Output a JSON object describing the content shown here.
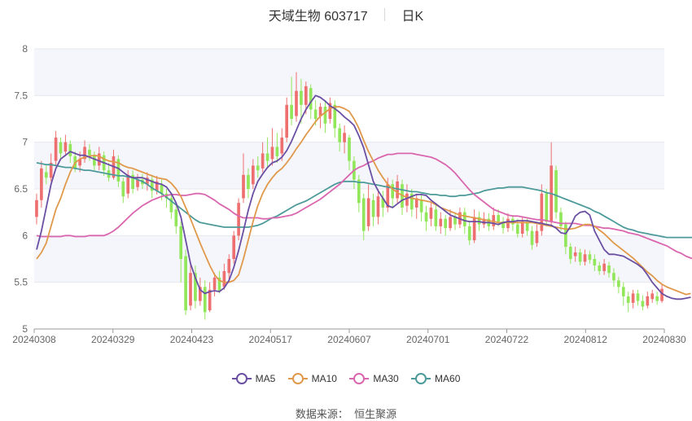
{
  "header": {
    "title": "天域生物 603717",
    "period": "日K"
  },
  "footer": {
    "source_label": "数据来源：",
    "source_name": "恒生聚源"
  },
  "colors": {
    "up": "#ee6f6f",
    "down": "#91e65a",
    "ma5": "#6a4fa3",
    "ma10": "#e0994b",
    "ma30": "#d966ae",
    "ma60": "#4d9a9a"
  },
  "chart_data": {
    "type": "candlestick",
    "x_tick_labels": [
      "20240308",
      "20240329",
      "20240423",
      "20240517",
      "20240607",
      "20240701",
      "20240722",
      "20240812",
      "20240830"
    ],
    "y_ticks": [
      "5",
      "5.5",
      "6",
      "6.5",
      "7",
      "7.5",
      "8"
    ],
    "ylim": [
      5,
      8
    ],
    "legend": [
      "MA5",
      "MA10",
      "MA30",
      "MA60"
    ],
    "candles": [
      {
        "o": 6.2,
        "c": 6.38,
        "h": 6.45,
        "l": 6.12
      },
      {
        "o": 6.38,
        "c": 6.72,
        "h": 6.8,
        "l": 6.3
      },
      {
        "o": 6.68,
        "c": 6.62,
        "h": 6.75,
        "l": 6.55
      },
      {
        "o": 6.62,
        "c": 6.78,
        "h": 6.88,
        "l": 6.58
      },
      {
        "o": 6.8,
        "c": 7.05,
        "h": 7.12,
        "l": 6.75
      },
      {
        "o": 7.0,
        "c": 6.88,
        "h": 7.05,
        "l": 6.82
      },
      {
        "o": 6.9,
        "c": 7.0,
        "h": 7.08,
        "l": 6.85
      },
      {
        "o": 6.98,
        "c": 6.85,
        "h": 7.02,
        "l": 6.78
      },
      {
        "o": 6.85,
        "c": 6.72,
        "h": 6.9,
        "l": 6.68
      },
      {
        "o": 6.75,
        "c": 6.82,
        "h": 6.9,
        "l": 6.68
      },
      {
        "o": 6.82,
        "c": 6.95,
        "h": 7.02,
        "l": 6.78
      },
      {
        "o": 6.92,
        "c": 6.86,
        "h": 6.98,
        "l": 6.8
      },
      {
        "o": 6.85,
        "c": 6.75,
        "h": 6.9,
        "l": 6.7
      },
      {
        "o": 6.75,
        "c": 6.88,
        "h": 6.95,
        "l": 6.7
      },
      {
        "o": 6.86,
        "c": 6.7,
        "h": 6.9,
        "l": 6.64
      },
      {
        "o": 6.7,
        "c": 6.62,
        "h": 6.78,
        "l": 6.58
      },
      {
        "o": 6.62,
        "c": 6.85,
        "h": 6.92,
        "l": 6.6
      },
      {
        "o": 6.82,
        "c": 6.58,
        "h": 6.86,
        "l": 6.52
      },
      {
        "o": 6.58,
        "c": 6.42,
        "h": 6.62,
        "l": 6.35
      },
      {
        "o": 6.45,
        "c": 6.65,
        "h": 6.7,
        "l": 6.4
      },
      {
        "o": 6.65,
        "c": 6.5,
        "h": 6.7,
        "l": 6.45
      },
      {
        "o": 6.52,
        "c": 6.6,
        "h": 6.66,
        "l": 6.48
      },
      {
        "o": 6.6,
        "c": 6.55,
        "h": 6.66,
        "l": 6.5
      },
      {
        "o": 6.55,
        "c": 6.62,
        "h": 6.68,
        "l": 6.48
      },
      {
        "o": 6.6,
        "c": 6.48,
        "h": 6.65,
        "l": 6.4
      },
      {
        "o": 6.48,
        "c": 6.58,
        "h": 6.64,
        "l": 6.44
      },
      {
        "o": 6.55,
        "c": 6.45,
        "h": 6.6,
        "l": 6.38
      },
      {
        "o": 6.45,
        "c": 6.4,
        "h": 6.5,
        "l": 6.3
      },
      {
        "o": 6.4,
        "c": 6.25,
        "h": 6.45,
        "l": 6.18
      },
      {
        "o": 6.28,
        "c": 6.1,
        "h": 6.32,
        "l": 6.02
      },
      {
        "o": 6.1,
        "c": 5.75,
        "h": 6.15,
        "l": 5.5
      },
      {
        "o": 5.78,
        "c": 5.2,
        "h": 5.85,
        "l": 5.15
      },
      {
        "o": 5.25,
        "c": 5.6,
        "h": 5.7,
        "l": 5.2
      },
      {
        "o": 5.6,
        "c": 5.3,
        "h": 5.68,
        "l": 5.22
      },
      {
        "o": 5.3,
        "c": 5.45,
        "h": 5.55,
        "l": 5.25
      },
      {
        "o": 5.45,
        "c": 5.18,
        "h": 5.52,
        "l": 5.1
      },
      {
        "o": 5.2,
        "c": 5.42,
        "h": 5.5,
        "l": 5.18
      },
      {
        "o": 5.42,
        "c": 5.55,
        "h": 5.6,
        "l": 5.35
      },
      {
        "o": 5.55,
        "c": 5.4,
        "h": 5.62,
        "l": 5.38
      },
      {
        "o": 5.45,
        "c": 5.62,
        "h": 5.7,
        "l": 5.42
      },
      {
        "o": 5.6,
        "c": 5.75,
        "h": 5.8,
        "l": 5.5
      },
      {
        "o": 5.75,
        "c": 6.0,
        "h": 6.05,
        "l": 5.7
      },
      {
        "o": 6.0,
        "c": 6.35,
        "h": 6.4,
        "l": 5.95
      },
      {
        "o": 6.4,
        "c": 6.65,
        "h": 6.88,
        "l": 6.35
      },
      {
        "o": 6.65,
        "c": 6.5,
        "h": 6.72,
        "l": 6.4
      },
      {
        "o": 6.55,
        "c": 6.75,
        "h": 6.82,
        "l": 6.5
      },
      {
        "o": 6.75,
        "c": 6.7,
        "h": 6.85,
        "l": 6.62
      },
      {
        "o": 6.72,
        "c": 6.88,
        "h": 7.0,
        "l": 6.68
      },
      {
        "o": 6.88,
        "c": 6.8,
        "h": 7.05,
        "l": 6.72
      },
      {
        "o": 6.82,
        "c": 6.95,
        "h": 7.15,
        "l": 6.75
      },
      {
        "o": 6.95,
        "c": 6.85,
        "h": 7.1,
        "l": 6.78
      },
      {
        "o": 6.88,
        "c": 7.05,
        "h": 7.15,
        "l": 6.8
      },
      {
        "o": 7.05,
        "c": 7.4,
        "h": 7.48,
        "l": 7.0
      },
      {
        "o": 7.4,
        "c": 7.25,
        "h": 7.7,
        "l": 7.18
      },
      {
        "o": 7.28,
        "c": 7.55,
        "h": 7.75,
        "l": 7.22
      },
      {
        "o": 7.55,
        "c": 7.4,
        "h": 7.68,
        "l": 7.2
      },
      {
        "o": 7.4,
        "c": 7.6,
        "h": 7.65,
        "l": 7.3
      },
      {
        "o": 7.58,
        "c": 7.35,
        "h": 7.62,
        "l": 7.25
      },
      {
        "o": 7.35,
        "c": 7.25,
        "h": 7.45,
        "l": 7.18
      },
      {
        "o": 7.28,
        "c": 7.38,
        "h": 7.42,
        "l": 7.15
      },
      {
        "o": 7.38,
        "c": 7.2,
        "h": 7.45,
        "l": 7.1
      },
      {
        "o": 7.25,
        "c": 7.42,
        "h": 7.48,
        "l": 7.2
      },
      {
        "o": 7.4,
        "c": 7.15,
        "h": 7.45,
        "l": 7.05
      },
      {
        "o": 7.15,
        "c": 7.0,
        "h": 7.2,
        "l": 6.9
      },
      {
        "o": 7.0,
        "c": 7.1,
        "h": 7.18,
        "l": 6.88
      },
      {
        "o": 7.05,
        "c": 6.8,
        "h": 7.08,
        "l": 6.7
      },
      {
        "o": 6.8,
        "c": 6.6,
        "h": 6.85,
        "l": 6.5
      },
      {
        "o": 6.6,
        "c": 6.35,
        "h": 6.65,
        "l": 6.25
      },
      {
        "o": 6.4,
        "c": 6.05,
        "h": 6.45,
        "l": 5.95
      },
      {
        "o": 6.1,
        "c": 6.4,
        "h": 6.55,
        "l": 6.05
      },
      {
        "o": 6.38,
        "c": 6.2,
        "h": 6.45,
        "l": 6.1
      },
      {
        "o": 6.2,
        "c": 6.42,
        "h": 6.5,
        "l": 6.12
      },
      {
        "o": 6.4,
        "c": 6.3,
        "h": 6.48,
        "l": 6.2
      },
      {
        "o": 6.3,
        "c": 6.55,
        "h": 6.62,
        "l": 6.25
      },
      {
        "o": 6.55,
        "c": 6.4,
        "h": 6.6,
        "l": 6.3
      },
      {
        "o": 6.4,
        "c": 6.58,
        "h": 6.65,
        "l": 6.35
      },
      {
        "o": 6.55,
        "c": 6.3,
        "h": 6.6,
        "l": 6.22
      },
      {
        "o": 6.32,
        "c": 6.45,
        "h": 6.55,
        "l": 6.25
      },
      {
        "o": 6.45,
        "c": 6.28,
        "h": 6.5,
        "l": 6.2
      },
      {
        "o": 6.3,
        "c": 6.4,
        "h": 6.45,
        "l": 6.18
      },
      {
        "o": 6.38,
        "c": 6.25,
        "h": 6.45,
        "l": 6.15
      },
      {
        "o": 6.25,
        "c": 6.15,
        "h": 6.32,
        "l": 6.05
      },
      {
        "o": 6.18,
        "c": 6.3,
        "h": 6.35,
        "l": 6.1
      },
      {
        "o": 6.28,
        "c": 6.1,
        "h": 6.32,
        "l": 6.05
      },
      {
        "o": 6.1,
        "c": 6.18,
        "h": 6.25,
        "l": 6.02
      },
      {
        "o": 6.18,
        "c": 6.08,
        "h": 6.22,
        "l": 6.0
      },
      {
        "o": 6.08,
        "c": 6.2,
        "h": 6.28,
        "l": 6.05
      },
      {
        "o": 6.2,
        "c": 6.12,
        "h": 6.25,
        "l": 6.06
      },
      {
        "o": 6.12,
        "c": 6.25,
        "h": 6.3,
        "l": 6.08
      },
      {
        "o": 6.25,
        "c": 6.1,
        "h": 6.3,
        "l": 6.02
      },
      {
        "o": 6.1,
        "c": 5.95,
        "h": 6.15,
        "l": 5.9
      },
      {
        "o": 5.95,
        "c": 6.2,
        "h": 6.28,
        "l": 5.92
      },
      {
        "o": 6.2,
        "c": 6.12,
        "h": 6.26,
        "l": 6.05
      },
      {
        "o": 6.12,
        "c": 6.18,
        "h": 6.25,
        "l": 6.08
      },
      {
        "o": 6.18,
        "c": 6.1,
        "h": 6.24,
        "l": 6.05
      },
      {
        "o": 6.1,
        "c": 6.22,
        "h": 6.3,
        "l": 6.06
      },
      {
        "o": 6.22,
        "c": 6.15,
        "h": 6.28,
        "l": 6.1
      },
      {
        "o": 6.15,
        "c": 6.08,
        "h": 6.2,
        "l": 6.02
      },
      {
        "o": 6.08,
        "c": 6.18,
        "h": 6.24,
        "l": 6.04
      },
      {
        "o": 6.18,
        "c": 6.12,
        "h": 6.22,
        "l": 6.05
      },
      {
        "o": 6.12,
        "c": 6.02,
        "h": 6.18,
        "l": 5.98
      },
      {
        "o": 6.02,
        "c": 6.15,
        "h": 6.2,
        "l": 5.98
      },
      {
        "o": 6.15,
        "c": 6.05,
        "h": 6.18,
        "l": 6.0
      },
      {
        "o": 6.05,
        "c": 5.9,
        "h": 6.1,
        "l": 5.85
      },
      {
        "o": 5.92,
        "c": 6.05,
        "h": 6.12,
        "l": 5.88
      },
      {
        "o": 6.05,
        "c": 6.45,
        "h": 6.55,
        "l": 6.0
      },
      {
        "o": 6.45,
        "c": 6.15,
        "h": 6.5,
        "l": 6.1
      },
      {
        "o": 6.15,
        "c": 6.75,
        "h": 7.0,
        "l": 6.1
      },
      {
        "o": 6.7,
        "c": 6.25,
        "h": 6.75,
        "l": 6.18
      },
      {
        "o": 6.25,
        "c": 6.1,
        "h": 6.3,
        "l": 6.05
      },
      {
        "o": 6.12,
        "c": 5.88,
        "h": 6.15,
        "l": 5.8
      },
      {
        "o": 5.88,
        "c": 5.75,
        "h": 5.92,
        "l": 5.7
      },
      {
        "o": 5.78,
        "c": 5.82,
        "h": 5.88,
        "l": 5.72
      },
      {
        "o": 5.82,
        "c": 5.72,
        "h": 5.86,
        "l": 5.68
      },
      {
        "o": 5.72,
        "c": 5.8,
        "h": 5.85,
        "l": 5.68
      },
      {
        "o": 5.8,
        "c": 5.74,
        "h": 5.84,
        "l": 5.7
      },
      {
        "o": 5.75,
        "c": 5.68,
        "h": 5.8,
        "l": 5.62
      },
      {
        "o": 5.68,
        "c": 5.62,
        "h": 5.72,
        "l": 5.58
      },
      {
        "o": 5.62,
        "c": 5.7,
        "h": 5.75,
        "l": 5.58
      },
      {
        "o": 5.68,
        "c": 5.6,
        "h": 5.72,
        "l": 5.55
      },
      {
        "o": 5.6,
        "c": 5.52,
        "h": 5.65,
        "l": 5.45
      },
      {
        "o": 5.52,
        "c": 5.45,
        "h": 5.56,
        "l": 5.38
      },
      {
        "o": 5.45,
        "c": 5.35,
        "h": 5.5,
        "l": 5.25
      },
      {
        "o": 5.35,
        "c": 5.28,
        "h": 5.4,
        "l": 5.18
      },
      {
        "o": 5.28,
        "c": 5.38,
        "h": 5.42,
        "l": 5.22
      },
      {
        "o": 5.38,
        "c": 5.3,
        "h": 5.42,
        "l": 5.25
      },
      {
        "o": 5.3,
        "c": 5.24,
        "h": 5.36,
        "l": 5.2
      },
      {
        "o": 5.25,
        "c": 5.35,
        "h": 5.4,
        "l": 5.22
      },
      {
        "o": 5.32,
        "c": 5.38,
        "h": 5.42,
        "l": 5.28
      },
      {
        "o": 5.35,
        "c": 5.3,
        "h": 5.4,
        "l": 5.26
      },
      {
        "o": 5.3,
        "c": 5.43,
        "h": 5.48,
        "l": 5.28
      }
    ],
    "ma5": [
      5.85,
      6.05,
      6.3,
      6.55,
      6.72,
      6.82,
      6.86,
      6.9,
      6.88,
      6.86,
      6.86,
      6.84,
      6.82,
      6.8,
      6.78,
      6.76,
      6.74,
      6.72,
      6.68,
      6.64,
      6.62,
      6.62,
      6.62,
      6.6,
      6.58,
      6.56,
      6.55,
      6.52,
      6.45,
      6.35,
      6.2,
      5.95,
      5.7,
      5.55,
      5.42,
      5.38,
      5.4,
      5.41,
      5.4,
      5.44,
      5.52,
      5.66,
      5.84,
      6.05,
      6.27,
      6.45,
      6.58,
      6.66,
      6.73,
      6.78,
      6.8,
      6.84,
      6.91,
      7.01,
      7.13,
      7.25,
      7.35,
      7.43,
      7.5,
      7.48,
      7.44,
      7.39,
      7.36,
      7.32,
      7.27,
      7.23,
      7.18,
      7.07,
      6.94,
      6.76,
      6.58,
      6.48,
      6.4,
      6.32,
      6.3,
      6.34,
      6.38,
      6.4,
      6.42,
      6.44,
      6.44,
      6.43,
      6.38,
      6.34,
      6.3,
      6.26,
      6.22,
      6.2,
      6.18,
      6.16,
      6.15,
      6.15,
      6.15,
      6.14,
      6.14,
      6.13,
      6.12,
      6.14,
      6.15,
      6.15,
      6.16,
      6.16,
      6.16,
      6.15,
      6.14,
      6.13,
      6.12,
      6.11,
      6.08,
      6.03,
      6.02,
      6.1,
      6.21,
      6.25,
      6.26,
      6.22,
      6.05,
      5.95,
      5.85,
      5.8,
      5.8,
      5.79,
      5.78,
      5.75,
      5.72,
      5.69,
      5.65,
      5.58,
      5.5,
      5.44,
      5.38,
      5.35,
      5.33,
      5.32,
      5.32,
      5.33,
      5.34
    ],
    "ma10": [
      5.75,
      5.82,
      5.92,
      6.1,
      6.28,
      6.4,
      6.55,
      6.68,
      6.78,
      6.82,
      6.84,
      6.85,
      6.86,
      6.85,
      6.82,
      6.8,
      6.79,
      6.78,
      6.75,
      6.73,
      6.72,
      6.7,
      6.68,
      6.66,
      6.64,
      6.62,
      6.61,
      6.6,
      6.56,
      6.5,
      6.42,
      6.3,
      6.18,
      6.05,
      5.92,
      5.8,
      5.68,
      5.58,
      5.52,
      5.5,
      5.5,
      5.52,
      5.58,
      5.75,
      5.95,
      6.15,
      6.32,
      6.45,
      6.55,
      6.62,
      6.68,
      6.72,
      6.78,
      6.85,
      6.93,
      7.0,
      7.08,
      7.15,
      7.22,
      7.28,
      7.32,
      7.36,
      7.38,
      7.38,
      7.36,
      7.33,
      7.25,
      7.15,
      7.02,
      6.9,
      6.8,
      6.7,
      6.62,
      6.55,
      6.5,
      6.46,
      6.43,
      6.41,
      6.4,
      6.39,
      6.38,
      6.37,
      6.36,
      6.33,
      6.3,
      6.28,
      6.26,
      6.24,
      6.22,
      6.21,
      6.2,
      6.19,
      6.18,
      6.17,
      6.16,
      6.15,
      6.14,
      6.14,
      6.14,
      6.14,
      6.14,
      6.14,
      6.14,
      6.14,
      6.13,
      6.12,
      6.11,
      6.1,
      6.09,
      6.08,
      6.07,
      6.07,
      6.08,
      6.1,
      6.12,
      6.12,
      6.1,
      6.06,
      6.02,
      5.97,
      5.92,
      5.88,
      5.84,
      5.8,
      5.76,
      5.71,
      5.66,
      5.61,
      5.57,
      5.52,
      5.48,
      5.45,
      5.43,
      5.41,
      5.39,
      5.37,
      5.38
    ],
    "ma30": [
      6.0,
      5.99,
      5.99,
      5.99,
      5.99,
      5.99,
      6.0,
      6.0,
      5.99,
      5.99,
      5.99,
      6.0,
      6.0,
      6.0,
      6.0,
      6.02,
      6.05,
      6.09,
      6.14,
      6.19,
      6.24,
      6.28,
      6.32,
      6.35,
      6.38,
      6.4,
      6.42,
      6.43,
      6.44,
      6.44,
      6.43,
      6.43,
      6.44,
      6.45,
      6.45,
      6.44,
      6.41,
      6.38,
      6.34,
      6.31,
      6.28,
      6.24,
      6.21,
      6.19,
      6.19,
      6.19,
      6.19,
      6.18,
      6.18,
      6.19,
      6.19,
      6.2,
      6.21,
      6.22,
      6.24,
      6.27,
      6.3,
      6.33,
      6.36,
      6.39,
      6.43,
      6.47,
      6.51,
      6.55,
      6.6,
      6.65,
      6.7,
      6.73,
      6.75,
      6.78,
      6.8,
      6.83,
      6.85,
      6.87,
      6.87,
      6.88,
      6.88,
      6.88,
      6.88,
      6.87,
      6.86,
      6.85,
      6.84,
      6.82,
      6.79,
      6.76,
      6.72,
      6.67,
      6.61,
      6.55,
      6.49,
      6.44,
      6.4,
      6.36,
      6.32,
      6.28,
      6.26,
      6.24,
      6.22,
      6.21,
      6.21,
      6.2,
      6.19,
      6.18,
      6.17,
      6.17,
      6.16,
      6.15,
      6.14,
      6.13,
      6.13,
      6.13,
      6.13,
      6.12,
      6.11,
      6.11,
      6.1,
      6.09,
      6.08,
      6.08,
      6.07,
      6.06,
      6.05,
      6.03,
      6.02,
      6.01,
      5.99,
      5.97,
      5.95,
      5.93,
      5.91,
      5.89,
      5.86,
      5.83,
      5.81,
      5.78,
      5.76,
      5.74
    ],
    "ma60": [
      6.78,
      6.77,
      6.76,
      6.76,
      6.75,
      6.74,
      6.73,
      6.73,
      6.72,
      6.71,
      6.7,
      6.7,
      6.69,
      6.68,
      6.67,
      6.66,
      6.65,
      6.64,
      6.64,
      6.63,
      6.62,
      6.6,
      6.58,
      6.55,
      6.51,
      6.48,
      6.45,
      6.41,
      6.37,
      6.33,
      6.29,
      6.25,
      6.21,
      6.17,
      6.14,
      6.13,
      6.12,
      6.11,
      6.1,
      6.09,
      6.09,
      6.09,
      6.09,
      6.09,
      6.09,
      6.1,
      6.11,
      6.13,
      6.16,
      6.19,
      6.21,
      6.24,
      6.27,
      6.3,
      6.33,
      6.35,
      6.37,
      6.4,
      6.43,
      6.46,
      6.49,
      6.52,
      6.55,
      6.57,
      6.58,
      6.58,
      6.58,
      6.57,
      6.57,
      6.56,
      6.55,
      6.54,
      6.53,
      6.52,
      6.51,
      6.5,
      6.49,
      6.48,
      6.47,
      6.47,
      6.46,
      6.45,
      6.44,
      6.44,
      6.43,
      6.43,
      6.42,
      6.42,
      6.43,
      6.43,
      6.44,
      6.45,
      6.46,
      6.48,
      6.49,
      6.5,
      6.51,
      6.51,
      6.52,
      6.52,
      6.52,
      6.52,
      6.51,
      6.5,
      6.49,
      6.48,
      6.46,
      6.45,
      6.43,
      6.41,
      6.39,
      6.37,
      6.35,
      6.33,
      6.31,
      6.29,
      6.26,
      6.24,
      6.21,
      6.18,
      6.15,
      6.12,
      6.09,
      6.07,
      6.06,
      6.04,
      6.03,
      6.02,
      6.01,
      6.0,
      5.99,
      5.98,
      5.98,
      5.98,
      5.98,
      5.98,
      5.98,
      5.98
    ]
  }
}
